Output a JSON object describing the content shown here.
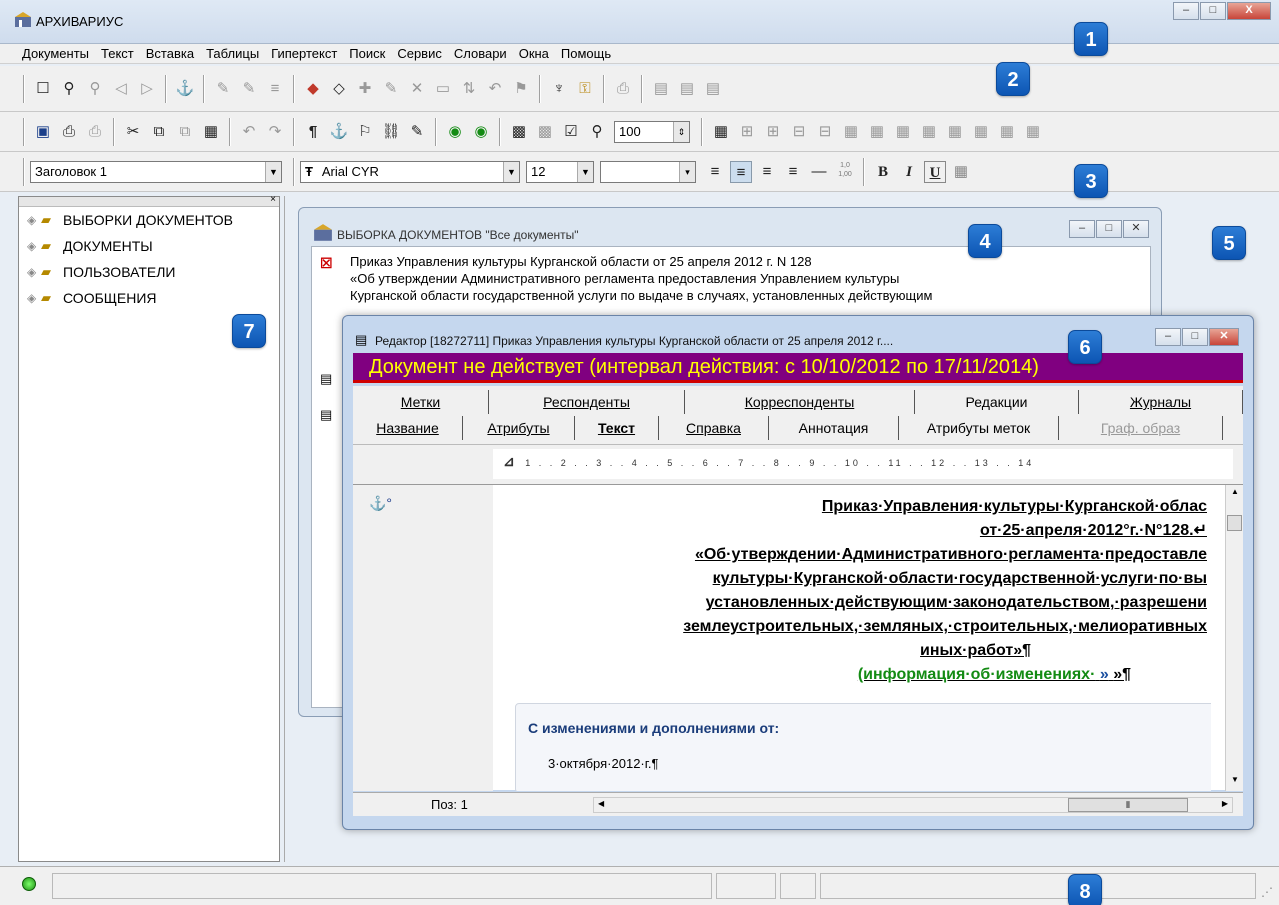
{
  "app": {
    "title": "АРХИВАРИУС",
    "window_buttons": [
      "–",
      "□",
      "X"
    ]
  },
  "menu": [
    "Документы",
    "Текст",
    "Вставка",
    "Таблицы",
    "Гипертекст",
    "Поиск",
    "Сервис",
    "Словари",
    "Окна",
    "Помощь"
  ],
  "toolbar3": {
    "style": "Заголовок 1",
    "font": "Arial CYR",
    "font_prefix": "Ŧ",
    "size": "12",
    "zoom": "100",
    "spacing": "1,0\n1,00",
    "bold": "B",
    "italic": "I",
    "underline": "U"
  },
  "markers": [
    "1",
    "2",
    "3",
    "4",
    "5",
    "6",
    "7",
    "8"
  ],
  "tree": [
    {
      "label": "ВЫБОРКИ ДОКУМЕНТОВ"
    },
    {
      "label": "ДОКУМЕНТЫ"
    },
    {
      "label": "ПОЛЬЗОВАТЕЛИ"
    },
    {
      "label": "СООБЩЕНИЯ"
    }
  ],
  "selection_window": {
    "title": "ВЫБОРКА ДОКУМЕНТОВ \"Все документы\"",
    "entry_line1": "Приказ Управления культуры Курганской области от 25 апреля 2012 г. N 128",
    "entry_line2": "«Об утверждении Административного регламента предоставления Управлением культуры",
    "entry_line3": "Курганской области государственной услуги по выдаче в случаях, установленных действующим"
  },
  "editor_window": {
    "title": "Редактор [18272711] Приказ Управления культуры Курганской области от 25 апреля 2012 г....",
    "banner": "Документ не действует (интервал действия: с 10/10/2012 по 17/11/2014)",
    "tabs_row1": [
      "Метки",
      "Респонденты",
      "Корреспонденты",
      "Редакции",
      "Журналы"
    ],
    "tabs_row2": [
      "Название",
      "Атрибуты",
      "Текст",
      "Справка",
      "Аннотация",
      "Атрибуты меток",
      "Граф. образ"
    ],
    "ruler_marks": "1 . . 2 . . 3 . . 4 . . 5 . . 6 . . 7 . . 8 . . 9 . . 10 . . 11 . . 12 . . 13 . . 14",
    "text_lines": [
      "Приказ·Управления·культуры·Курганской·облас",
      "от·25·апреля·2012°г.·N°128.↵",
      "«Об·утверждении·Административного·регламента·предоставле",
      "культуры·Курганской·области·государственной·услуги·по·вы",
      "установленных·действующим·законодательством,·разрешени",
      "землеустроительных,·земляных,·строительных,·мелиоративных",
      "иных·работ»¶"
    ],
    "info_link": "(информация·об·изменениях·",
    "info_tail": "»¶",
    "popup_header": "С изменениями и дополнениями от:",
    "popup_date": "3·октября·2012·г.¶",
    "status_pos": "Поз: 1"
  }
}
